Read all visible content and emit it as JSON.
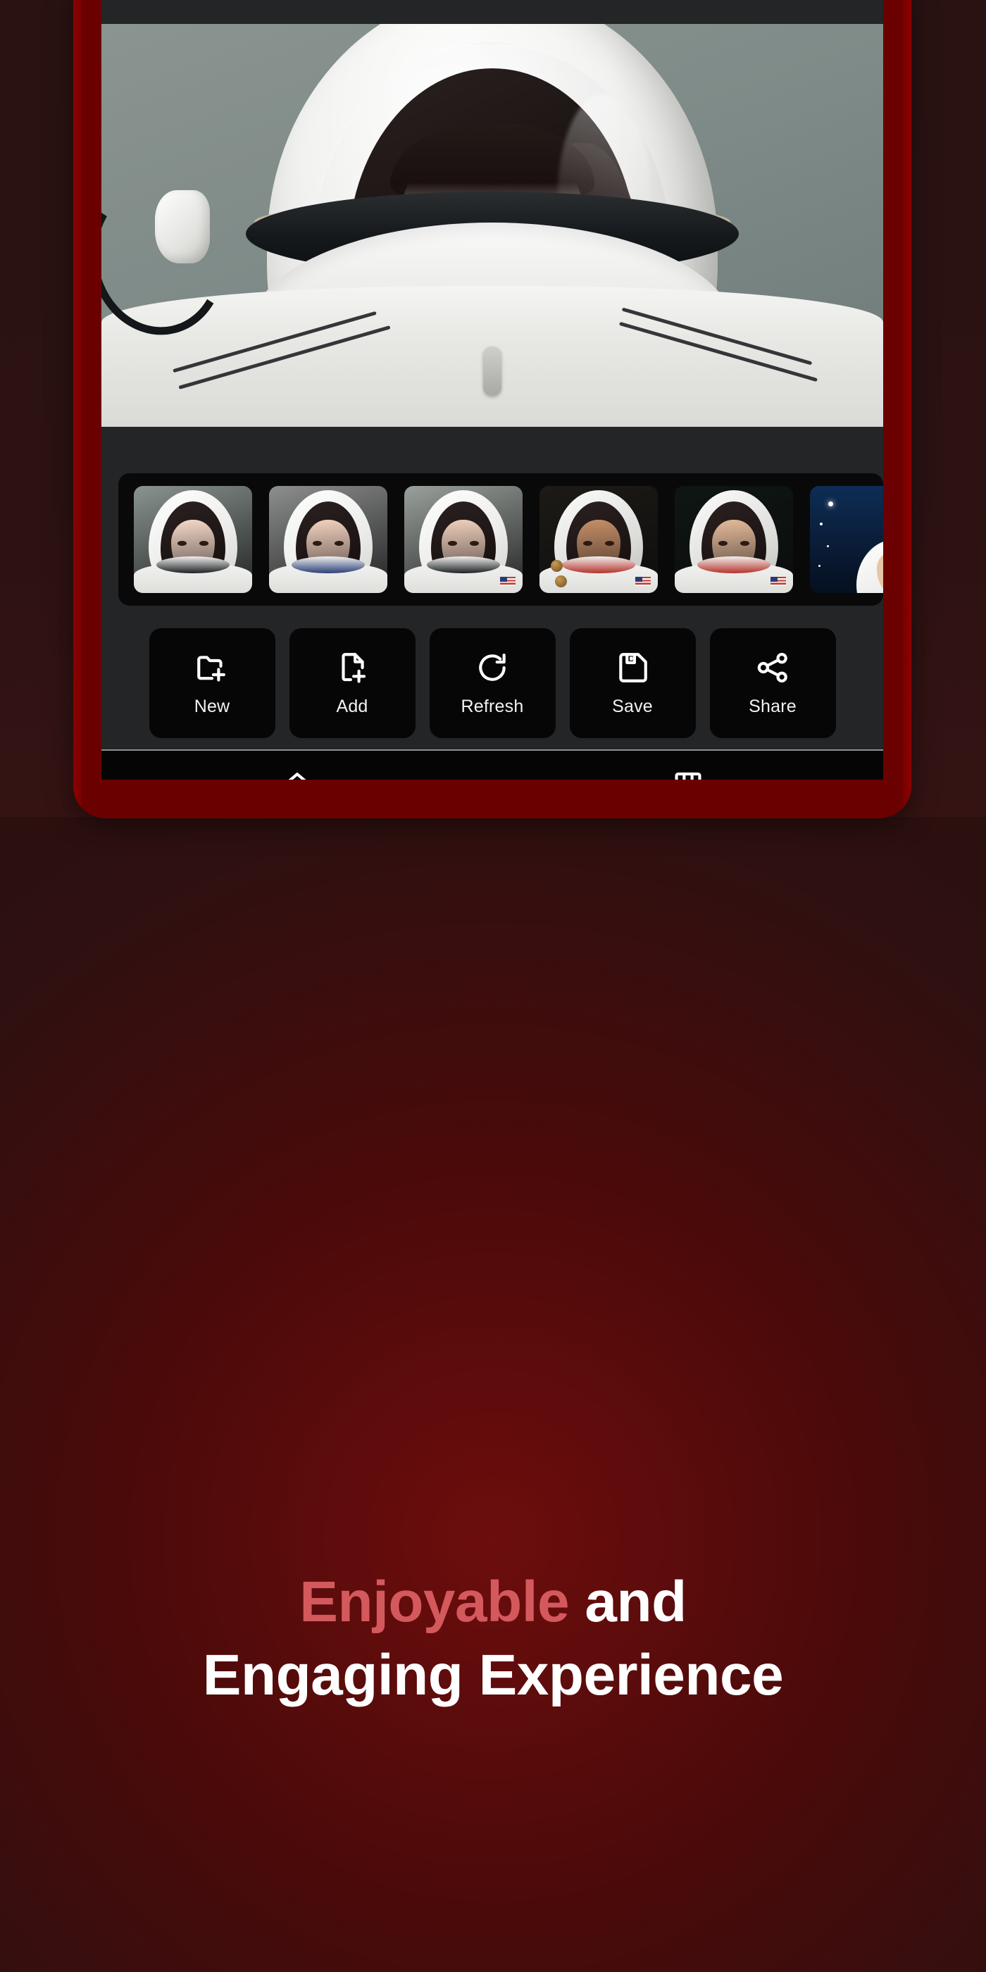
{
  "app": {
    "phone_frame_color": "#6b0000",
    "screen_bg": "#232527",
    "background_color": "#2a1111"
  },
  "hero": {
    "alt": "astronaut-portrait-main",
    "description": "Woman in white space helmet, grey-green background"
  },
  "thumbnails": {
    "count": 6,
    "items": [
      {
        "alt": "astronaut-thumb-1",
        "bg": "#8a9490",
        "skin": "#f4d9c9",
        "selected": true
      },
      {
        "alt": "astronaut-thumb-2",
        "bg": "#8d8f8e",
        "skin": "#f2d2c0",
        "selected": false
      },
      {
        "alt": "astronaut-thumb-3",
        "bg": "#9aa09c",
        "skin": "#efd0bd",
        "selected": false
      },
      {
        "alt": "astronaut-thumb-4",
        "bg": "#1d1a16",
        "skin": "#c58f68",
        "selected": false
      },
      {
        "alt": "astronaut-thumb-5",
        "bg": "#0e1614",
        "skin": "#e4bb9b",
        "selected": false
      },
      {
        "alt": "astronaut-thumb-6",
        "bg": "#0d2a4a",
        "skin": "#e8c4a6",
        "selected": false
      }
    ]
  },
  "toolbar": {
    "buttons": [
      {
        "label": "New",
        "icon": "folder-plus-icon"
      },
      {
        "label": "Add",
        "icon": "file-plus-icon"
      },
      {
        "label": "Refresh",
        "icon": "refresh-icon"
      },
      {
        "label": "Save",
        "icon": "floppy-disk-icon"
      },
      {
        "label": "Share",
        "icon": "share-nodes-icon"
      }
    ]
  },
  "bottom_nav": {
    "active_color": "#f5f50a",
    "inactive_color": "#ffffff",
    "items": [
      {
        "label": "Home",
        "icon": "home-icon",
        "active": true
      },
      {
        "label": "Saved",
        "icon": "bookmark-book-icon",
        "active": false
      }
    ]
  },
  "headline": {
    "accent_color": "#d4595c",
    "line1_accent": "Enjoyable",
    "line1_rest": " and",
    "line2": "Engaging Experience"
  }
}
